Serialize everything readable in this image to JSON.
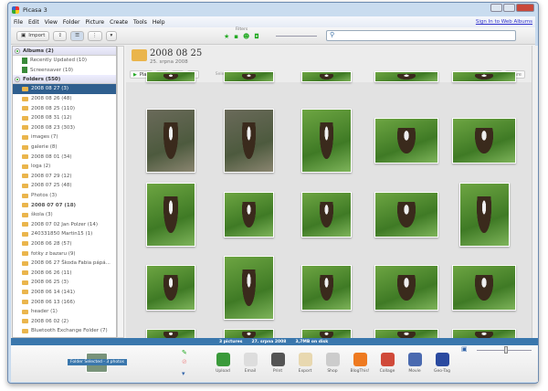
{
  "window": {
    "title": "Picasa 3"
  },
  "menu": [
    "File",
    "Edit",
    "View",
    "Folder",
    "Picture",
    "Create",
    "Tools",
    "Help"
  ],
  "sign_in": "Sign In to Web Albums",
  "toolbar": {
    "import": "Import",
    "filters": "Filters"
  },
  "search": {
    "placeholder": ""
  },
  "albums": {
    "header": "Albums (2)",
    "items": [
      "Recently Updated (10)",
      "Screensaver (10)"
    ]
  },
  "folders": {
    "header": "Folders (550)",
    "items": [
      {
        "label": "2008 08 27 (3)",
        "selected": true
      },
      {
        "label": "2008 08 26 (48)"
      },
      {
        "label": "2008 08 25 (110)"
      },
      {
        "label": "2008 08 31 (12)"
      },
      {
        "label": "2008 08 23 (303)"
      },
      {
        "label": "images (7)"
      },
      {
        "label": "galerie (8)"
      },
      {
        "label": "2008 08 01 (34)"
      },
      {
        "label": "loga (2)"
      },
      {
        "label": "2008 07 29 (12)"
      },
      {
        "label": "2008 07 25 (48)"
      },
      {
        "label": "Photos (3)"
      },
      {
        "label": "2008 07 07 (18)",
        "bold": true
      },
      {
        "label": "škola (3)"
      },
      {
        "label": "2008 07 02 Jan Polzer (14)"
      },
      {
        "label": "240331850 Martin15 (1)"
      },
      {
        "label": "2008 06 28 (57)"
      },
      {
        "label": "fotky z bazaru (9)"
      },
      {
        "label": "2008 06 27 Škoda Fabia pápá..."
      },
      {
        "label": "2008 06 26 (11)"
      },
      {
        "label": "2008 06 25 (3)"
      },
      {
        "label": "2008 06 14 (141)"
      },
      {
        "label": "2008 06 13 (166)"
      },
      {
        "label": "header (1)"
      },
      {
        "label": "2008 06 02 (2)"
      },
      {
        "label": "Bluetooth Exchange Folder (7)"
      }
    ]
  },
  "folder_view": {
    "title": "2008 08 25",
    "subtitle": "25. srpna 2008",
    "play": "Play",
    "select": "Select",
    "sync": "Sync to Web",
    "share": "Share"
  },
  "status": {
    "pictures": "3 pictures",
    "date": "27. srpna 2008",
    "size": "3,7MB on disk"
  },
  "tray": {
    "selection": "Folder Selected - 3 photos",
    "actions": [
      {
        "label": "Upload",
        "color": "#3a9a3a"
      },
      {
        "label": "Email",
        "color": "#ddd"
      },
      {
        "label": "Print",
        "color": "#555"
      },
      {
        "label": "Export",
        "color": "#e8d8b0"
      },
      {
        "label": "Shop",
        "color": "#ccc"
      },
      {
        "label": "BlogThis!",
        "color": "#ee7a20"
      },
      {
        "label": "Collage",
        "color": "#d04a3a"
      },
      {
        "label": "Movie",
        "color": "#4a6ab0"
      },
      {
        "label": "Geo-Tag",
        "color": "#2a4aa0"
      }
    ]
  }
}
